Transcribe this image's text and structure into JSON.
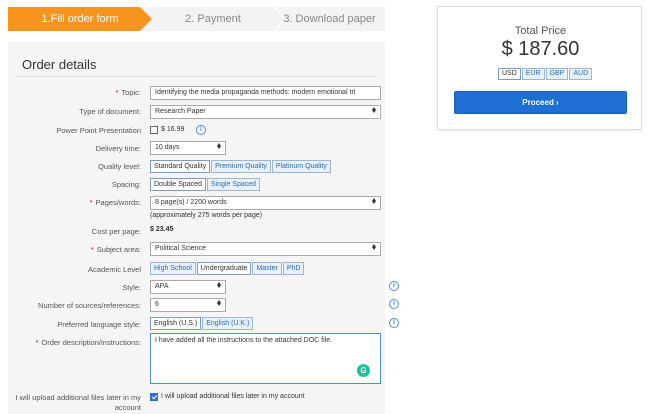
{
  "steps": {
    "step1": "1.Fill order form",
    "step2": "2. Payment",
    "step3": "3. Download paper"
  },
  "form": {
    "title": "Order details",
    "topic": {
      "label": "Topic:",
      "value": "Identifying the media propaganda methods: modern emotional tri"
    },
    "doc_type": {
      "label": "Type of document:",
      "value": "Research Paper"
    },
    "ppt": {
      "label": "Power Point Presentation",
      "price": "$ 16.99",
      "checked": false
    },
    "delivery": {
      "label": "Delivery time:",
      "value": "10 days"
    },
    "quality": {
      "label": "Quality level:",
      "options": [
        "Standard Quality",
        "Premium Quality",
        "Platinum Quality"
      ],
      "selected": "Standard Quality"
    },
    "spacing": {
      "label": "Spacing:",
      "options": [
        "Double Spaced",
        "Single Spaced"
      ],
      "selected": "Double Spaced"
    },
    "pages": {
      "label": "Pages/words:",
      "value": "8 page(s) / 2200 words",
      "note": "(approximately 275 words per page)"
    },
    "cost_per_page": {
      "label": "Cost per page:",
      "value": "$ 23.45"
    },
    "subject": {
      "label": "Subject area:",
      "value": "Political Science"
    },
    "academic": {
      "label": "Academic Level",
      "options": [
        "High School",
        "Undergraduate",
        "Master",
        "PhD"
      ],
      "selected": "Undergraduate"
    },
    "style": {
      "label": "Style:",
      "value": "APA"
    },
    "sources": {
      "label": "Number of sources/references:",
      "value": "6"
    },
    "language": {
      "label": "Preferred language style:",
      "options": [
        "English (U.S.)",
        "English (U.K.)"
      ],
      "selected": "English (U.S.)"
    },
    "description": {
      "label": "Order description/instructions:",
      "value": "I have added all the instructions to the attached DOC file."
    },
    "upload": {
      "label_line1": "I will upload additional files later in my",
      "label_line2": "account",
      "checkbox_label": "I will upload additional files later in my account",
      "checked": true
    }
  },
  "price": {
    "label": "Total Price",
    "value": "$ 187.60",
    "currencies": [
      "USD",
      "EUR",
      "GBP",
      "AUD"
    ],
    "selected_currency": "USD",
    "proceed_label": "Proceed ›"
  },
  "icons": {
    "info": "info-icon",
    "grammarly": "grammarly-icon"
  },
  "colors": {
    "accent_orange": "#f7941d",
    "primary_blue": "#1f6ed4",
    "required_red": "#d0021b"
  }
}
